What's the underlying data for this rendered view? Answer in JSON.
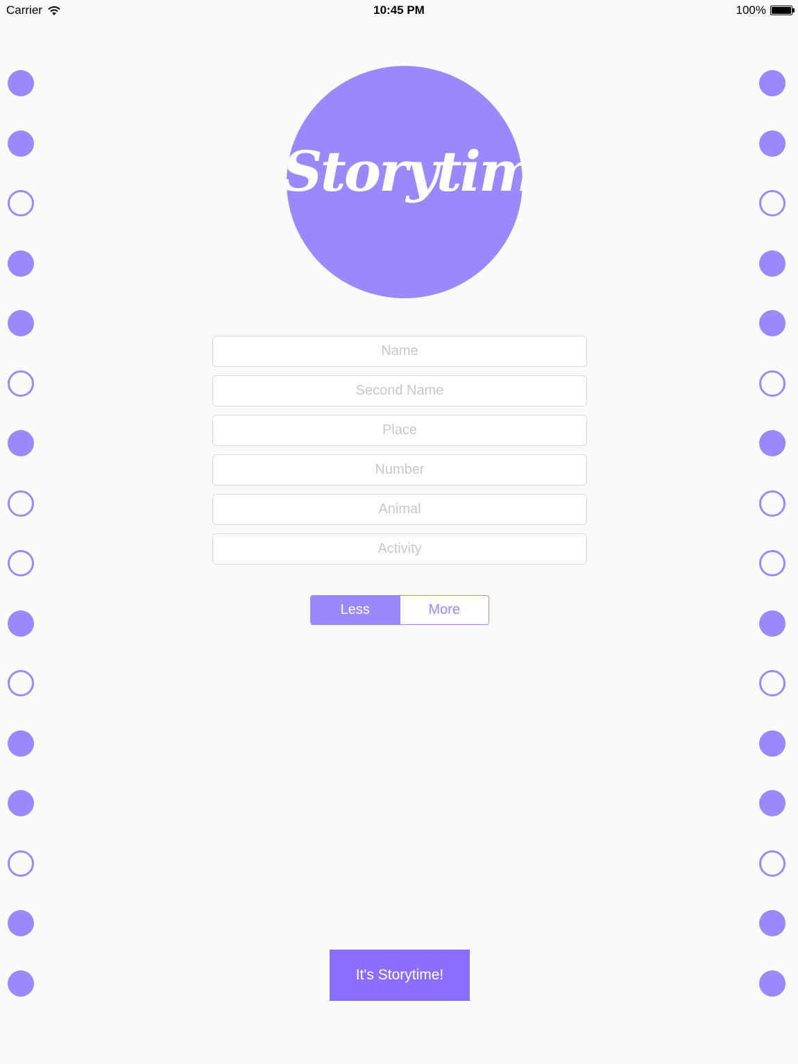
{
  "status_bar": {
    "carrier": "Carrier",
    "time": "10:45 PM",
    "battery": "100%"
  },
  "colors": {
    "accent": "#9a88ff",
    "button": "#8a6fff",
    "background": "#fafafa"
  },
  "logo": {
    "text": "Storytime"
  },
  "form": {
    "fields": [
      {
        "placeholder": "Name",
        "value": ""
      },
      {
        "placeholder": "Second Name",
        "value": ""
      },
      {
        "placeholder": "Place",
        "value": ""
      },
      {
        "placeholder": "Number",
        "value": ""
      },
      {
        "placeholder": "Animal",
        "value": ""
      },
      {
        "placeholder": "Activity",
        "value": ""
      }
    ]
  },
  "segmented": {
    "options": [
      "Less",
      "More"
    ],
    "selected": "Less"
  },
  "go_button": {
    "label": "It's Storytime!"
  },
  "decor": {
    "dots": [
      "filled",
      "filled",
      "hollow",
      "filled",
      "filled",
      "hollow",
      "filled",
      "hollow",
      "hollow",
      "filled",
      "hollow",
      "filled",
      "filled",
      "hollow",
      "filled",
      "filled"
    ]
  }
}
